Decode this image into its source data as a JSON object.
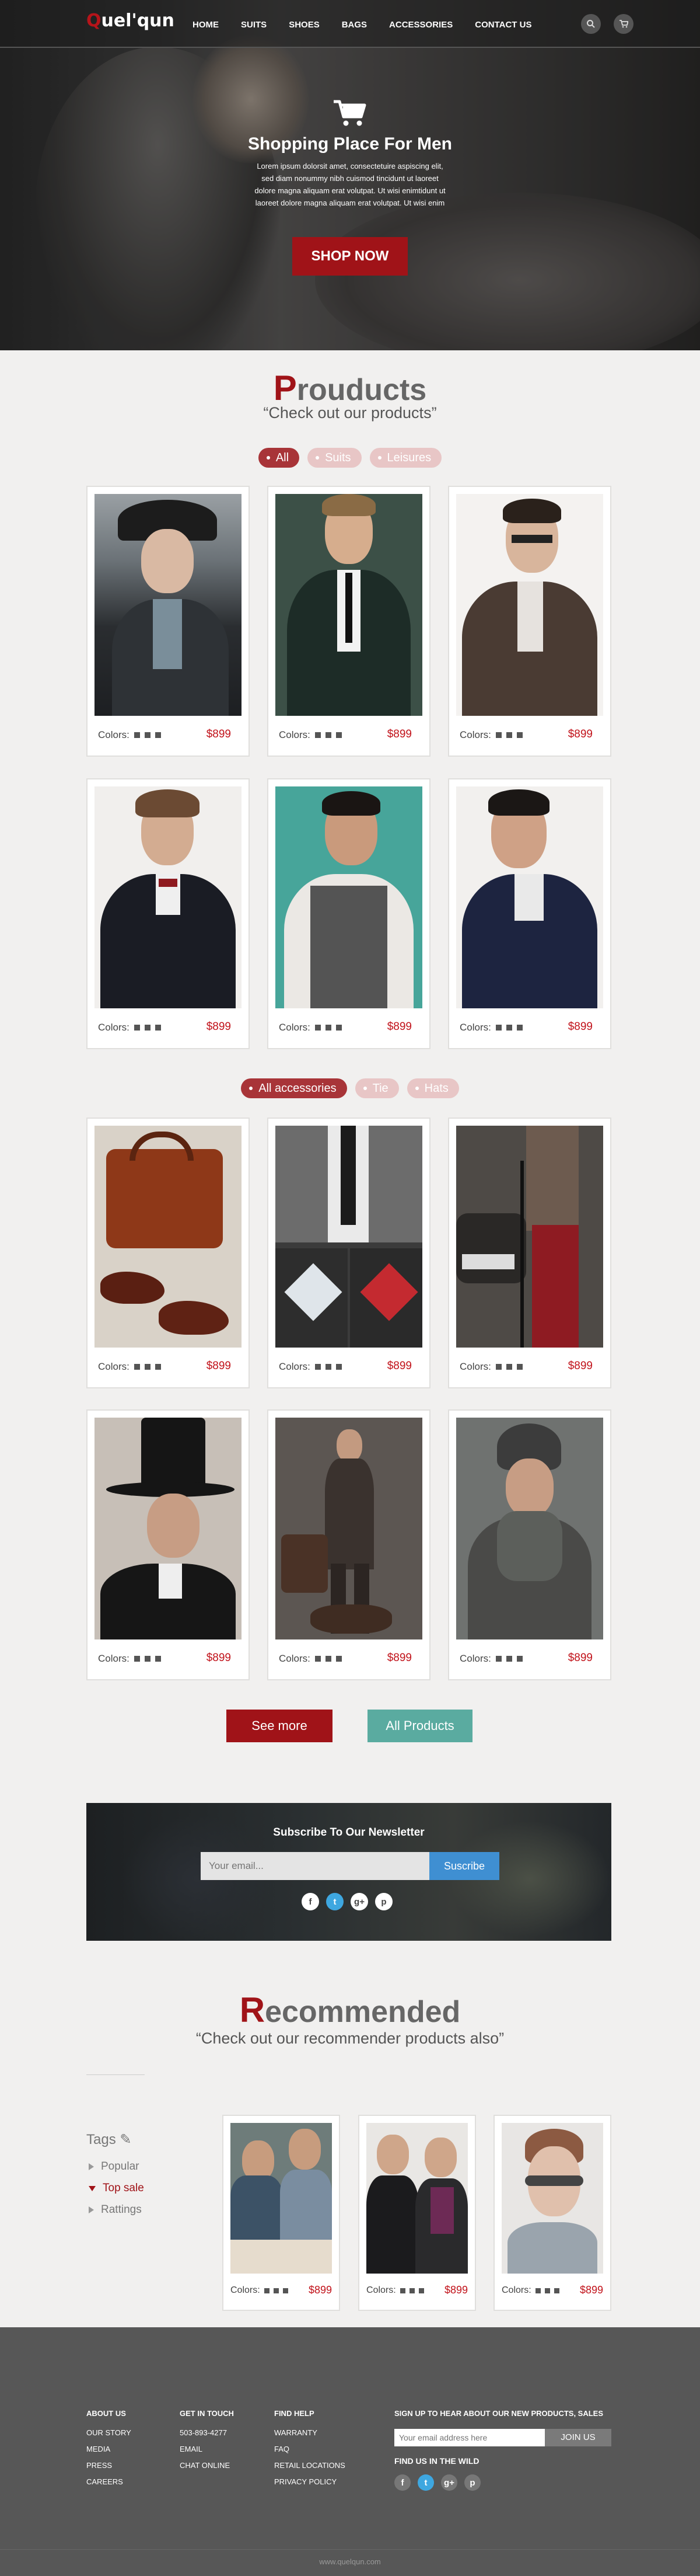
{
  "header": {
    "logo_q": "Q",
    "logo_rest": "uel'qun",
    "menu": [
      "HOME",
      "SUITS",
      "SHOES",
      "BAGS",
      "ACCESSORIES",
      "CONTACT US"
    ],
    "icons": [
      "search-icon",
      "cart-icon"
    ]
  },
  "hero": {
    "title": "Shopping Place For Men",
    "text": "Lorem ipsum dolorsit amet, consectetuire aspiscing elit, sed diam nonummy nibh cuismod tincidunt ut laoreet dolore magna aliquam erat volutpat. Ut wisi enimtidunt ut laoreet dolore magna aliquam erat volutpat. Ut wisi enim",
    "cta": "SHOP NOW"
  },
  "products": {
    "title_cap": "P",
    "title_rest": "rouducts",
    "subtitle": "“Check out our products”",
    "filters": [
      "All",
      "Suits",
      "Leisures"
    ],
    "filters2": [
      "All accessories",
      "Tie",
      "Hats"
    ],
    "colors_label": "Colors:",
    "items": [
      {
        "price": "$899"
      },
      {
        "price": "$899"
      },
      {
        "price": "$899"
      },
      {
        "price": "$899"
      },
      {
        "price": "$899"
      },
      {
        "price": "$899"
      },
      {
        "price": "$899"
      },
      {
        "price": "$899"
      },
      {
        "price": "$899"
      },
      {
        "price": "$899"
      },
      {
        "price": "$899"
      },
      {
        "price": "$899"
      }
    ],
    "see_more": "See more",
    "all_products": "All Products"
  },
  "newsletter": {
    "title": "Subscribe To Our Newsletter",
    "placeholder": "Your email...",
    "button": "Suscribe",
    "social": [
      "f",
      "t",
      "g+",
      "p"
    ]
  },
  "recommended": {
    "title_cap": "R",
    "title_rest": "ecommended",
    "subtitle": "“Check out our recommender products also”",
    "tags_title": "Tags",
    "tags": [
      "Popular",
      "Top sale",
      "Rattings"
    ],
    "active_tag": "Top sale",
    "colors_label": "Colors:",
    "items": [
      {
        "price": "$899"
      },
      {
        "price": "$899"
      },
      {
        "price": "$899"
      }
    ]
  },
  "footer": {
    "about_title": "ABOUT US",
    "about": [
      "OUR STORY",
      "MEDIA",
      "PRESS",
      "CAREERS"
    ],
    "touch_title": "GET IN TOUCH",
    "touch": [
      "503-893-4277",
      "EMAIL",
      "CHAT ONLINE"
    ],
    "help_title": "FIND HELP",
    "help": [
      "WARRANTY",
      "FAQ",
      "RETAIL LOCATIONS",
      "PRIVACY POLICY"
    ],
    "signup_title": "SIGN UP TO HEAR ABOUT OUR NEW PRODUCTS, SALES",
    "email_placeholder": "Your email address here",
    "join": "JOIN US",
    "wild_title": "FIND US IN THE WILD",
    "social": [
      "f",
      "t",
      "g+",
      "p"
    ],
    "copyright": "www.quelqun.com"
  }
}
